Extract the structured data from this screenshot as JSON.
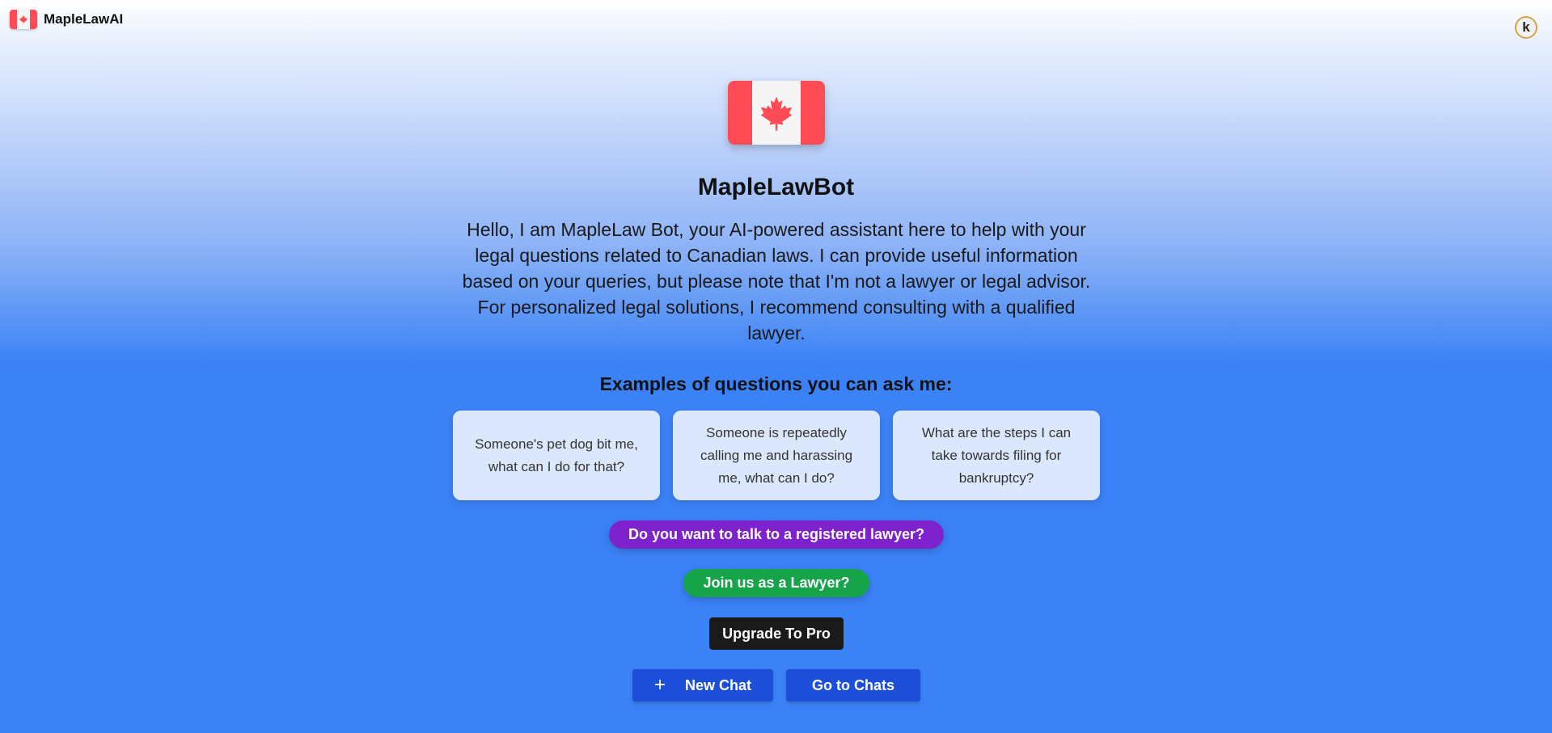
{
  "header": {
    "brand_name": "MapleLawAI",
    "brand_icon": "canada-flag-icon",
    "avatar_letter": "k"
  },
  "main": {
    "hero_icon": "canada-flag-icon",
    "title": "MapleLawBot",
    "intro": "Hello, I am MapleLaw Bot, your AI-powered assistant here to help with your legal questions related to Canadian laws. I can provide useful information based on your queries, but please note that I'm not a lawyer or legal advisor. For personalized legal solutions, I recommend consulting with a qualified lawyer.",
    "examples_title": "Examples of questions you can ask me:",
    "examples": [
      "Someone's pet dog bit me, what can I do for that?",
      "Someone is repeatedly calling me and harassing me, what can I do?",
      "What are the steps I can take towards filing for bankruptcy?"
    ]
  },
  "actions": {
    "talk_lawyer": "Do you want to talk to a registered lawyer?",
    "join_lawyer": "Join us as a Lawyer?",
    "upgrade": "Upgrade To Pro",
    "new_chat": "New Chat",
    "go_chats": "Go to Chats"
  },
  "colors": {
    "flag_red": "#ff4b55",
    "background_blue": "#3b82f6",
    "card_bg": "#dbe7fc",
    "purple": "#7e22ce",
    "green": "#16a34a",
    "dark": "#1a1a1a",
    "button_blue": "#1d4ed8"
  }
}
